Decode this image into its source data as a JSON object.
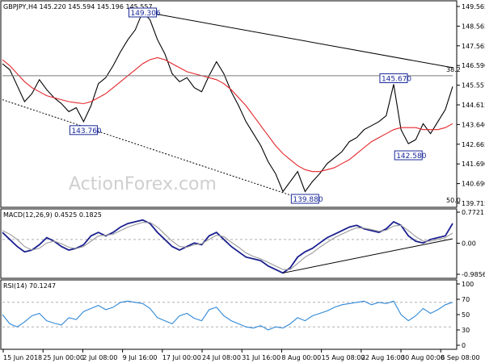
{
  "chart_data": [
    {
      "id": "price",
      "type": "line",
      "title": "GBPJPY,H4  145.220 145.594 145.196 145.557",
      "ylim": [
        139.715,
        149.565
      ],
      "y_ticks": [
        "149.565",
        "148.565",
        "147.565",
        "146.590",
        "145.557",
        "144.615",
        "143.640",
        "142.665",
        "141.690",
        "140.690",
        "139.715"
      ],
      "series": [
        {
          "color": "#000000",
          "values": [
            146.7,
            146.4,
            145.6,
            144.8,
            145.2,
            145.9,
            145.4,
            145.0,
            144.7,
            144.3,
            144.5,
            143.8,
            144.6,
            145.7,
            146.0,
            146.6,
            147.3,
            147.9,
            148.4,
            149.3,
            148.9,
            147.9,
            147.2,
            146.2,
            145.8,
            146.0,
            145.5,
            145.3,
            146.1,
            146.8,
            146.2,
            145.3,
            144.6,
            143.8,
            143.2,
            142.6,
            141.8,
            141.2,
            140.3,
            140.8,
            141.3,
            140.3,
            140.8,
            141.2,
            141.7,
            142.0,
            142.3,
            142.8,
            143.0,
            143.4,
            143.6,
            143.8,
            144.1,
            145.67,
            143.4,
            142.7,
            142.9,
            143.7,
            143.2,
            143.8,
            144.4,
            145.557
          ]
        },
        {
          "color": "#e3262b",
          "values": [
            146.9,
            146.6,
            146.2,
            145.8,
            145.5,
            145.3,
            145.1,
            145.0,
            144.9,
            144.8,
            144.75,
            144.7,
            144.8,
            145.0,
            145.2,
            145.5,
            145.8,
            146.1,
            146.4,
            146.7,
            146.9,
            147.0,
            146.9,
            146.7,
            146.5,
            146.3,
            146.2,
            146.1,
            146.0,
            145.9,
            145.7,
            145.4,
            145.0,
            144.6,
            144.1,
            143.6,
            143.1,
            142.6,
            142.2,
            141.9,
            141.6,
            141.4,
            141.3,
            141.3,
            141.4,
            141.5,
            141.7,
            141.9,
            142.2,
            142.5,
            142.8,
            143.0,
            143.2,
            143.4,
            143.5,
            143.5,
            143.5,
            143.4,
            143.4,
            143.4,
            143.5,
            143.7
          ]
        }
      ],
      "x_labels": [
        "15 Jun 2018",
        "25 Jun 00:00",
        "2 Jul 08:00",
        "9 Jul 16:00",
        "17 Jul 00:00",
        "24 Jul 08:00",
        "31 Jul 16:00",
        "8 Aug 00:00",
        "15 Aug 08:00",
        "22 Aug 16:00",
        "30 Aug 00:00",
        "6 Sep 08:00"
      ],
      "annotations": [
        {
          "text": "149.306",
          "index": 19,
          "value": 149.306
        },
        {
          "text": "143.760",
          "index": 11,
          "value": 143.76
        },
        {
          "text": "139.880",
          "index": 41,
          "value": 139.88
        },
        {
          "text": "145.670",
          "index": 53,
          "value": 145.67
        },
        {
          "text": "142.580",
          "index": 55,
          "value": 142.58
        }
      ],
      "fib_labels": [
        "38.2",
        "50.0"
      ],
      "horizontal_line": 146.1,
      "grid": false
    },
    {
      "id": "macd",
      "type": "line",
      "title": "MACD(12,26,9) 0.4525 0.1825",
      "ylim": [
        -0.9856,
        0.7721
      ],
      "y_ticks": [
        "0.7721",
        "0.00",
        "-0.9856"
      ],
      "series": [
        {
          "color": "#1a1f8f",
          "values": [
            0.2,
            0.0,
            -0.2,
            -0.35,
            -0.3,
            -0.15,
            0.05,
            -0.05,
            -0.2,
            -0.3,
            -0.25,
            -0.15,
            0.1,
            0.2,
            0.1,
            0.2,
            0.35,
            0.45,
            0.5,
            0.55,
            0.45,
            0.2,
            0.0,
            -0.2,
            -0.3,
            -0.2,
            -0.1,
            -0.15,
            0.1,
            0.2,
            0.0,
            -0.2,
            -0.35,
            -0.5,
            -0.55,
            -0.6,
            -0.75,
            -0.85,
            -0.95,
            -0.8,
            -0.5,
            -0.35,
            -0.25,
            -0.1,
            0.05,
            0.15,
            0.25,
            0.35,
            0.4,
            0.3,
            0.25,
            0.2,
            0.3,
            0.5,
            0.4,
            0.1,
            -0.05,
            -0.1,
            0.0,
            0.05,
            0.1,
            0.4525
          ]
        },
        {
          "color": "#9a9a9a",
          "values": [
            0.25,
            0.15,
            0.0,
            -0.2,
            -0.3,
            -0.25,
            -0.1,
            -0.05,
            -0.12,
            -0.22,
            -0.26,
            -0.2,
            -0.05,
            0.1,
            0.12,
            0.15,
            0.25,
            0.35,
            0.42,
            0.48,
            0.48,
            0.35,
            0.15,
            -0.05,
            -0.2,
            -0.22,
            -0.15,
            -0.12,
            0.0,
            0.12,
            0.08,
            -0.08,
            -0.22,
            -0.38,
            -0.48,
            -0.55,
            -0.65,
            -0.75,
            -0.85,
            -0.85,
            -0.68,
            -0.5,
            -0.38,
            -0.22,
            -0.08,
            0.05,
            0.15,
            0.25,
            0.33,
            0.32,
            0.28,
            0.23,
            0.26,
            0.38,
            0.4,
            0.25,
            0.08,
            -0.05,
            -0.05,
            0.0,
            0.05,
            0.1825
          ]
        }
      ],
      "zero_line": 0,
      "grid": false
    },
    {
      "id": "rsi",
      "type": "line",
      "title": "RSI(14) 70.1247",
      "ylim": [
        0,
        100
      ],
      "y_ticks": [
        "100",
        "70",
        "50",
        "30",
        "0"
      ],
      "reference_levels": [
        70,
        30
      ],
      "series": [
        {
          "color": "#2f88d6",
          "values": [
            50,
            35,
            30,
            38,
            48,
            52,
            40,
            36,
            33,
            45,
            42,
            55,
            60,
            65,
            58,
            62,
            70,
            72,
            70,
            68,
            60,
            45,
            40,
            35,
            48,
            52,
            44,
            40,
            58,
            62,
            48,
            40,
            35,
            30,
            28,
            32,
            25,
            30,
            28,
            35,
            45,
            40,
            48,
            52,
            56,
            62,
            66,
            68,
            70,
            72,
            66,
            70,
            68,
            72,
            50,
            40,
            48,
            60,
            52,
            58,
            66,
            70.1247
          ]
        }
      ],
      "grid": false
    }
  ],
  "watermark": {
    "text": "ActionForex.com"
  }
}
